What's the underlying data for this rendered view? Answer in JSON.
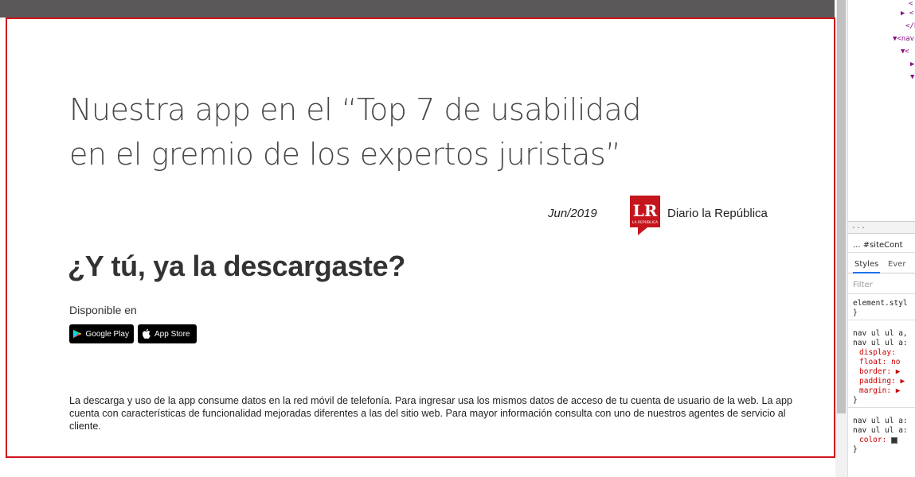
{
  "article": {
    "headline_line1": "Nuestra app en el “Top 7 de usabilidad",
    "headline_line2": "en el gremio de los expertos juristas”",
    "date": "Jun/2019",
    "source_logo_text": "LR",
    "source_logo_subtext": "LA REPÚBLICA",
    "source_name": "Diario la República",
    "cta": "¿Y tú, ya la descargaste?",
    "available_label": "Disponible en",
    "google_play_label": "Google Play",
    "app_store_label": "App Store",
    "disclaimer": "La descarga y uso de la app consume datos en la red móvil de telefonía. Para ingresar usa los mismos datos de acceso de tu cuenta de usuario de la web. La app cuenta con características de funcionalidad mejoradas diferentes a las del sitio web. Para mayor información consulta con uno de nuestros agentes de servicio al cliente."
  },
  "devtools": {
    "dom_lines": [
      "<",
      "▶ <",
      "</h",
      "▼<nav",
      "▼<",
      "▶",
      "▼"
    ],
    "splitter_text": "...",
    "breadcrumb": "...  #siteCont",
    "tab_styles": "Styles",
    "tab_events": "Ever",
    "filter_placeholder": "Filter",
    "rule_lines": [
      "element.styl",
      "}",
      "nav ul ul a,",
      "nav ul ul a:",
      "display:",
      "float: no",
      "border: ▶",
      "padding: ▶",
      "margin: ▶",
      "}",
      "nav ul ul a:",
      "nav ul ul a:",
      "color:",
      "}"
    ]
  },
  "colors": {
    "frame_border": "#d0141b",
    "topbar": "#5a5858",
    "logo_red": "#c4161c",
    "button_bg": "#000000"
  }
}
